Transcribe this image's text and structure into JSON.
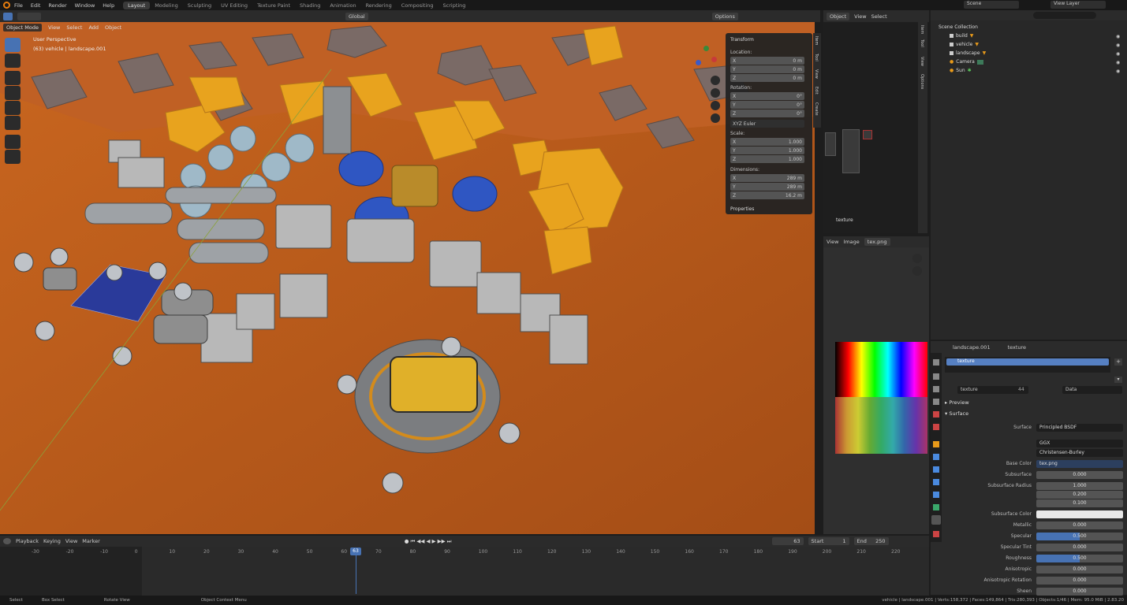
{
  "menu": {
    "items": [
      "File",
      "Edit",
      "Render",
      "Window",
      "Help"
    ]
  },
  "workspaces": [
    {
      "label": "Layout",
      "active": true
    },
    {
      "label": "Modeling"
    },
    {
      "label": "Sculpting"
    },
    {
      "label": "UV Editing"
    },
    {
      "label": "Texture Paint"
    },
    {
      "label": "Shading"
    },
    {
      "label": "Animation"
    },
    {
      "label": "Rendering"
    },
    {
      "label": "Compositing"
    },
    {
      "label": "Scripting"
    }
  ],
  "top_right": {
    "scene": "Scene",
    "view_layer": "View Layer"
  },
  "header3d": {
    "mode": "Object Mode",
    "menus": [
      "View",
      "Select",
      "Add",
      "Object"
    ],
    "transform": "Global",
    "options": "Options"
  },
  "overlay": {
    "perspective": "User Perspective",
    "object": "(63) vehicle | landscape.001"
  },
  "npanel": {
    "title": "Transform",
    "location": "Location:",
    "loc": [
      "0 m",
      "0 m",
      "0 m"
    ],
    "rotation": "Rotation:",
    "rot": [
      "0°",
      "0°",
      "0°"
    ],
    "euler": "XYZ Euler",
    "scale": "Scale:",
    "scl": [
      "1.000",
      "1.000",
      "1.000"
    ],
    "dimensions": "Dimensions:",
    "dim": [
      "289 m",
      "289 m",
      "16.2 m"
    ],
    "properties": "Properties",
    "axes": [
      "X",
      "Y",
      "Z"
    ],
    "tabs": [
      "Item",
      "Tool",
      "View",
      "Edit",
      "Create"
    ]
  },
  "node_editor": {
    "menus": [
      "Object",
      "View",
      "Select"
    ],
    "label": "texture",
    "side_tabs": [
      "Item",
      "Tool",
      "View",
      "Options"
    ]
  },
  "image_editor": {
    "menus": [
      "View",
      "Image"
    ],
    "file": "tex.png"
  },
  "outliner": {
    "title": "Scene Collection",
    "items": [
      "build",
      "vehicle",
      "landscape",
      "Camera",
      "Sun"
    ]
  },
  "properties": {
    "breadcrumb": [
      "landscape.001",
      "texture"
    ],
    "slot": "texture",
    "material": "texture",
    "users": "44",
    "data": "Data",
    "sections": [
      "Preview",
      "Surface"
    ],
    "rows": [
      [
        "Surface",
        "Principled BSDF"
      ],
      [
        "",
        "GGX"
      ],
      [
        "",
        "Christensen-Burley"
      ],
      [
        "Base Color",
        "tex.png"
      ],
      [
        "Subsurface",
        "0.000"
      ],
      [
        "Subsurface Radius",
        "1.000"
      ],
      [
        "",
        "0.200"
      ],
      [
        "",
        "0.100"
      ],
      [
        "Subsurface Color",
        ""
      ],
      [
        "Metallic",
        "0.000"
      ],
      [
        "Specular",
        "0.500"
      ],
      [
        "Specular Tint",
        "0.000"
      ],
      [
        "Roughness",
        "0.500"
      ],
      [
        "Anisotropic",
        "0.000"
      ],
      [
        "Anisotropic Rotation",
        "0.000"
      ],
      [
        "Sheen",
        "0.000"
      ]
    ]
  },
  "timeline": {
    "menus": [
      "Playback",
      "Keying",
      "View",
      "Marker"
    ],
    "current": "63",
    "start_label": "Start",
    "start": "1",
    "end_label": "End",
    "end": "250",
    "ticks": [
      "-30",
      "-20",
      "-10",
      "0",
      "10",
      "20",
      "30",
      "40",
      "50",
      "60",
      "70",
      "80",
      "90",
      "100",
      "110",
      "120",
      "130",
      "140",
      "150",
      "160",
      "170",
      "180",
      "190",
      "200",
      "210",
      "220"
    ]
  },
  "status": {
    "left": [
      "Select",
      "Box Select",
      "Rotate View",
      "Object Context Menu"
    ],
    "right": "vehicle | landscape.001 | Verts:158,372 | Faces:149,864 | Tris:280,393 | Objects:1/46 | Mem: 95.0 MiB | 2.83.20"
  },
  "colors": {
    "accent": "#4772b3",
    "ground": "#b3561a",
    "rocks": "#d88a1e"
  }
}
